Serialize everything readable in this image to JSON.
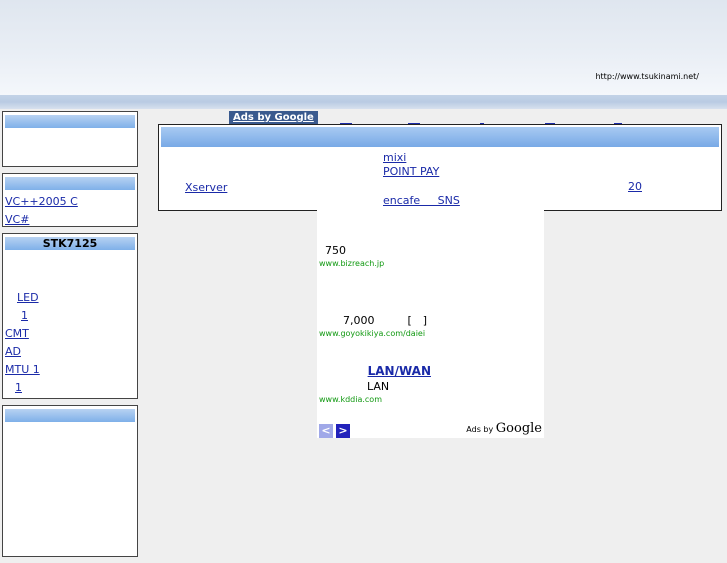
{
  "header": {
    "url": "http://www.tsukinami.net/"
  },
  "sidebar": {
    "box1": {
      "title": "",
      "links": [
        ""
      ]
    },
    "box2": {
      "title": "",
      "links": [
        "VC++2005 C",
        "VC#"
      ]
    },
    "box3": {
      "title": "STK7125",
      "links": [
        "",
        "",
        "LED",
        "1",
        "CMT",
        "AD",
        "MTU 1",
        "1"
      ]
    },
    "box4": {
      "title": "",
      "links": [
        "",
        "",
        "",
        "",
        "",
        "",
        ""
      ]
    }
  },
  "ads_top": {
    "badge": "Ads by Google"
  },
  "link_table": {
    "col1": [
      "",
      "",
      "Xserver",
      ""
    ],
    "col2": [
      "mixi",
      "POINT PAY",
      "",
      "encafe SNS"
    ],
    "col3": [
      "",
      "",
      "20",
      ""
    ]
  },
  "adbox": {
    "ads": [
      {
        "title": "",
        "text": "750",
        "url": "www.bizreach.jp"
      },
      {
        "title": "",
        "text": "7,000　　　[　]",
        "url": "www.goyokikiya.com/daiei"
      },
      {
        "title": "LAN/WAN",
        "text": "LAN",
        "url": "www.kddia.com"
      }
    ],
    "prev": "<",
    "next": ">",
    "ads_by": "Ads by",
    "google": "Google"
  }
}
